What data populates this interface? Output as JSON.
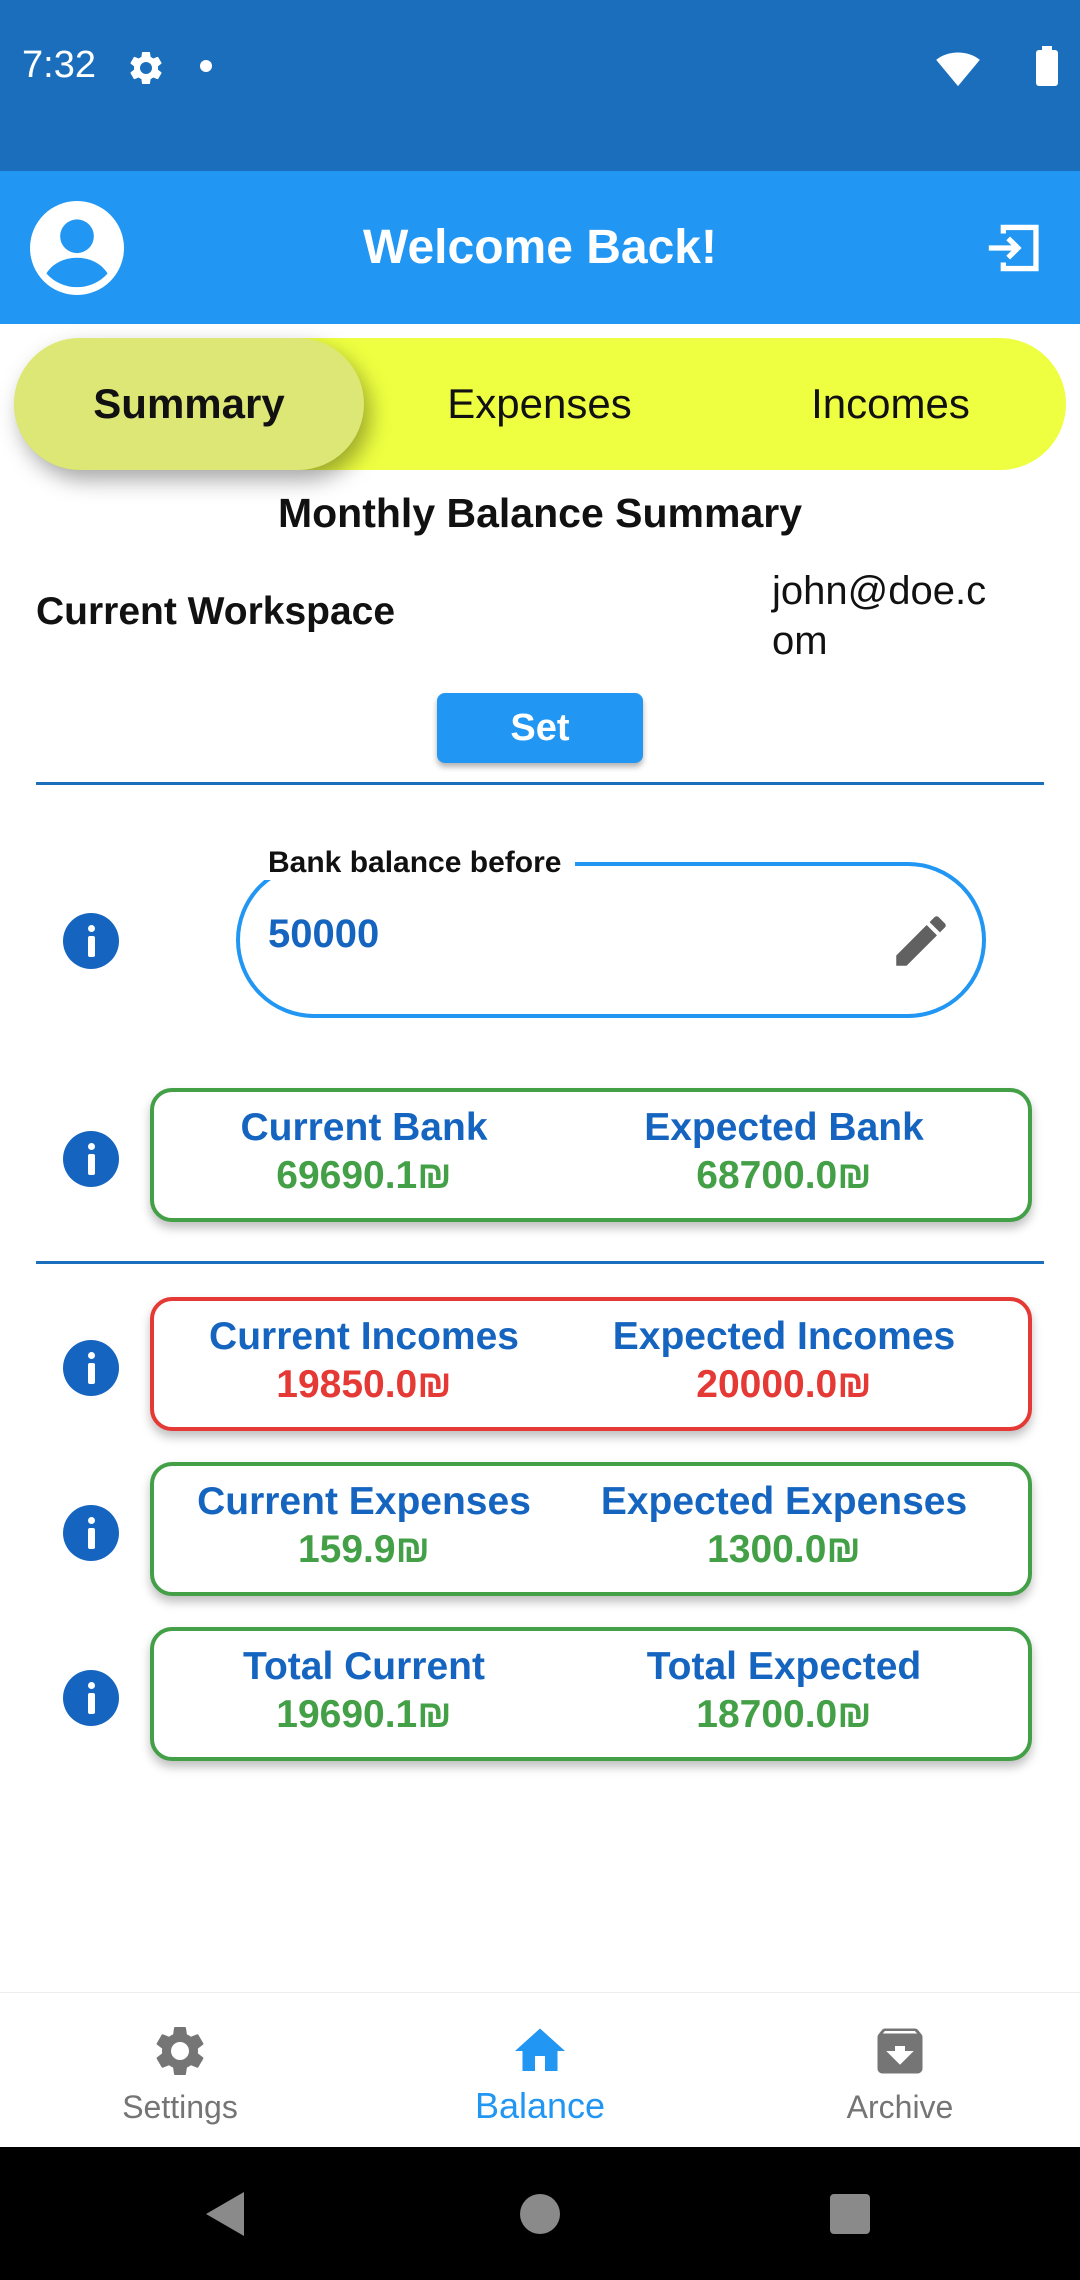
{
  "status_bar": {
    "time": "7:32"
  },
  "app_bar": {
    "title": "Welcome Back!"
  },
  "tabs": [
    {
      "label": "Summary",
      "active": true
    },
    {
      "label": "Expenses",
      "active": false
    },
    {
      "label": "Incomes",
      "active": false
    }
  ],
  "summary": {
    "title": "Monthly Balance Summary",
    "workspace_label": "Current Workspace",
    "workspace_value": "john@doe.com",
    "set_label": "Set",
    "bank_before_label": "Bank balance before",
    "bank_before_value": "50000"
  },
  "cards": [
    {
      "left_label": "Current Bank",
      "left_value": "69690.1₪",
      "right_label": "Expected Bank",
      "right_value": "68700.0₪",
      "status": "green"
    },
    {
      "left_label": "Current Incomes",
      "left_value": "19850.0₪",
      "right_label": "Expected Incomes",
      "right_value": "20000.0₪",
      "status": "red"
    },
    {
      "left_label": "Current Expenses",
      "left_value": "159.9₪",
      "right_label": "Expected Expenses",
      "right_value": "1300.0₪",
      "status": "green"
    },
    {
      "left_label": "Total Current",
      "left_value": "19690.1₪",
      "right_label": "Total Expected",
      "right_value": "18700.0₪",
      "status": "green"
    }
  ],
  "bottom_nav": [
    {
      "label": "Settings",
      "icon": "gear-icon",
      "active": false
    },
    {
      "label": "Balance",
      "icon": "home-icon",
      "active": true
    },
    {
      "label": "Archive",
      "icon": "archive-icon",
      "active": false
    }
  ],
  "colors": {
    "status_bar": "#1b6ebb",
    "app_bar": "#2196f3",
    "tab_bar": "#eeff41",
    "tab_active": "#dce775",
    "label_blue": "#1565c0",
    "ok_green": "#43a047",
    "alert_red": "#e53935"
  }
}
